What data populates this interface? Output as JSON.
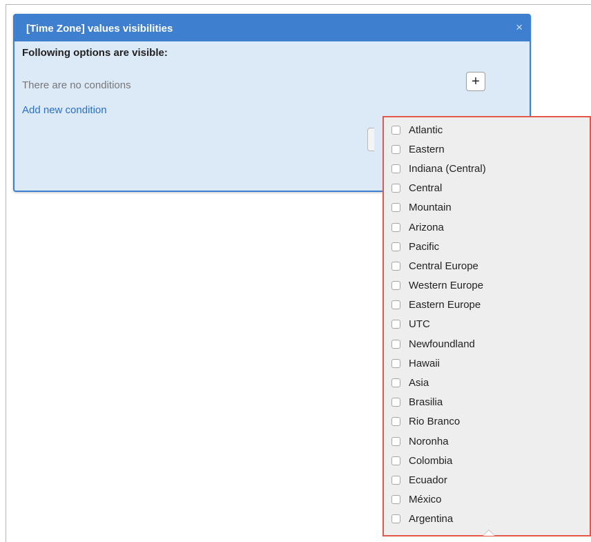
{
  "dialog": {
    "title": "[Time Zone] values visibilities",
    "close_glyph": "×",
    "heading": "Following options are visible:",
    "empty_text": "There are no conditions",
    "add_link": "Add new condition",
    "add_button_glyph": "+"
  },
  "dropdown": {
    "options": [
      {
        "label": "Atlantic",
        "checked": false
      },
      {
        "label": "Eastern",
        "checked": false
      },
      {
        "label": "Indiana (Central)",
        "checked": false
      },
      {
        "label": "Central",
        "checked": false
      },
      {
        "label": "Mountain",
        "checked": false
      },
      {
        "label": "Arizona",
        "checked": false
      },
      {
        "label": "Pacific",
        "checked": false
      },
      {
        "label": "Central Europe",
        "checked": false
      },
      {
        "label": "Western Europe",
        "checked": false
      },
      {
        "label": "Eastern Europe",
        "checked": false
      },
      {
        "label": "UTC",
        "checked": false
      },
      {
        "label": "Newfoundland",
        "checked": false
      },
      {
        "label": "Hawaii",
        "checked": false
      },
      {
        "label": "Asia",
        "checked": false
      },
      {
        "label": "Brasilia",
        "checked": false
      },
      {
        "label": "Rio Branco",
        "checked": false
      },
      {
        "label": "Noronha",
        "checked": false
      },
      {
        "label": "Colombia",
        "checked": false
      },
      {
        "label": "Ecuador",
        "checked": false
      },
      {
        "label": "México",
        "checked": false
      },
      {
        "label": "Argentina",
        "checked": false
      }
    ]
  },
  "colors": {
    "dialog_header": "#3f7fd0",
    "dialog_body": "#dce9f7",
    "link": "#2a6fc9",
    "dropdown_highlight_border": "#e4564a",
    "dropdown_background": "#eeeeee"
  }
}
